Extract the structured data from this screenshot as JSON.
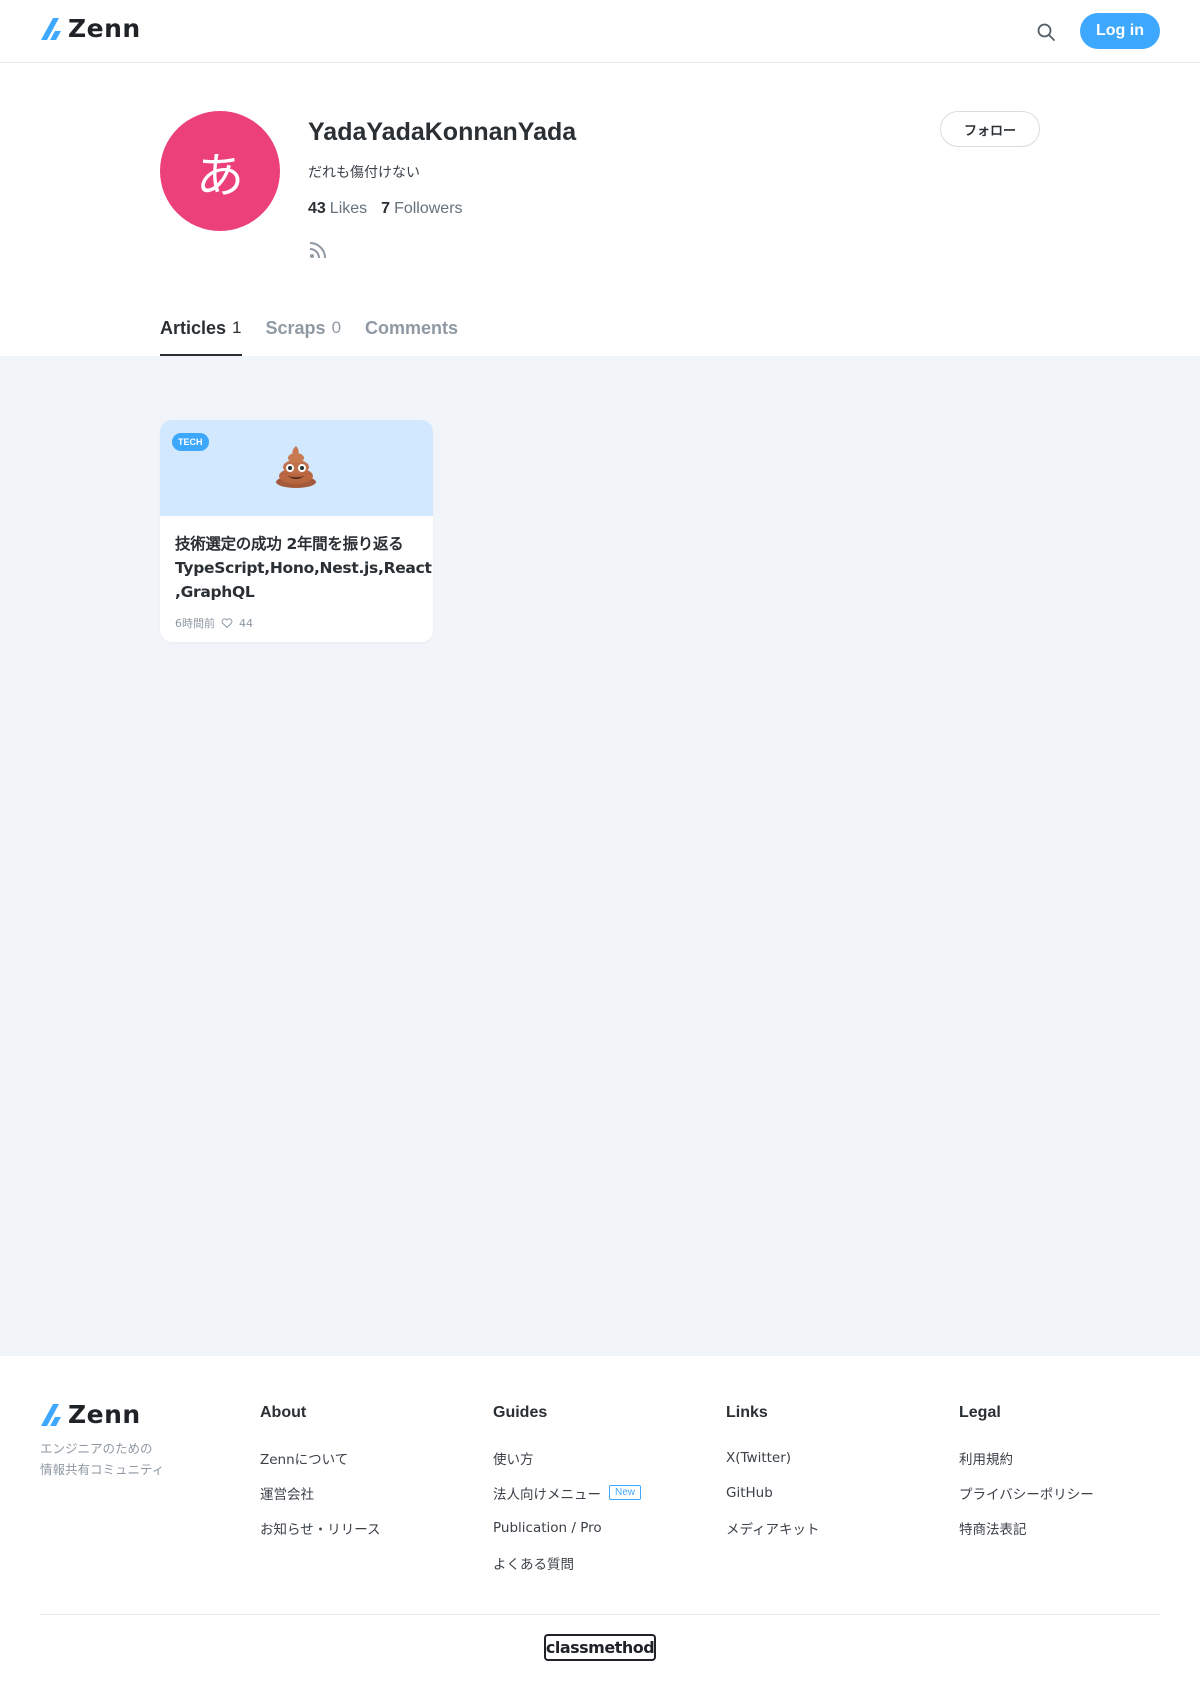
{
  "header": {
    "logo_text": "Zenn",
    "login_label": "Log in",
    "colors": {
      "accent": "#3ea8ff",
      "text": "#1f2328"
    }
  },
  "profile": {
    "avatar_char": "あ",
    "avatar_color": "#ec407a",
    "name": "YadaYadaKonnanYada",
    "bio": "だれも傷付けない",
    "likes_count": "43",
    "likes_label": "Likes",
    "followers_count": "7",
    "followers_label": "Followers",
    "follow_label": "フォロー"
  },
  "tabs": [
    {
      "label": "Articles",
      "count": "1",
      "active": true
    },
    {
      "label": "Scraps",
      "count": "0",
      "active": false
    },
    {
      "label": "Comments",
      "count": "",
      "active": false
    }
  ],
  "articles": [
    {
      "badge": "TECH",
      "emoji": "poop-icon",
      "title": "技術選定の成功 2年間を振り返る TypeScript,Hono,Nest.js,React ,GraphQL",
      "time": "6時間前",
      "likes": "44"
    }
  ],
  "footer": {
    "logo_text": "Zenn",
    "tagline_line1": "エンジニアのための",
    "tagline_line2": "情報共有コミュニティ",
    "columns": [
      {
        "title": "About",
        "links": [
          "Zennについて",
          "運営会社",
          "お知らせ・リリース"
        ]
      },
      {
        "title": "Guides",
        "links": [
          "使い方",
          "法人向けメニュー",
          "Publication / Pro",
          "よくある質問"
        ],
        "new_badge": "New"
      },
      {
        "title": "Links",
        "links": [
          "X(Twitter)",
          "GitHub",
          "メディアキット"
        ]
      },
      {
        "title": "Legal",
        "links": [
          "利用規約",
          "プライバシーポリシー",
          "特商法表記"
        ]
      }
    ],
    "sponsor": "classmethod"
  }
}
